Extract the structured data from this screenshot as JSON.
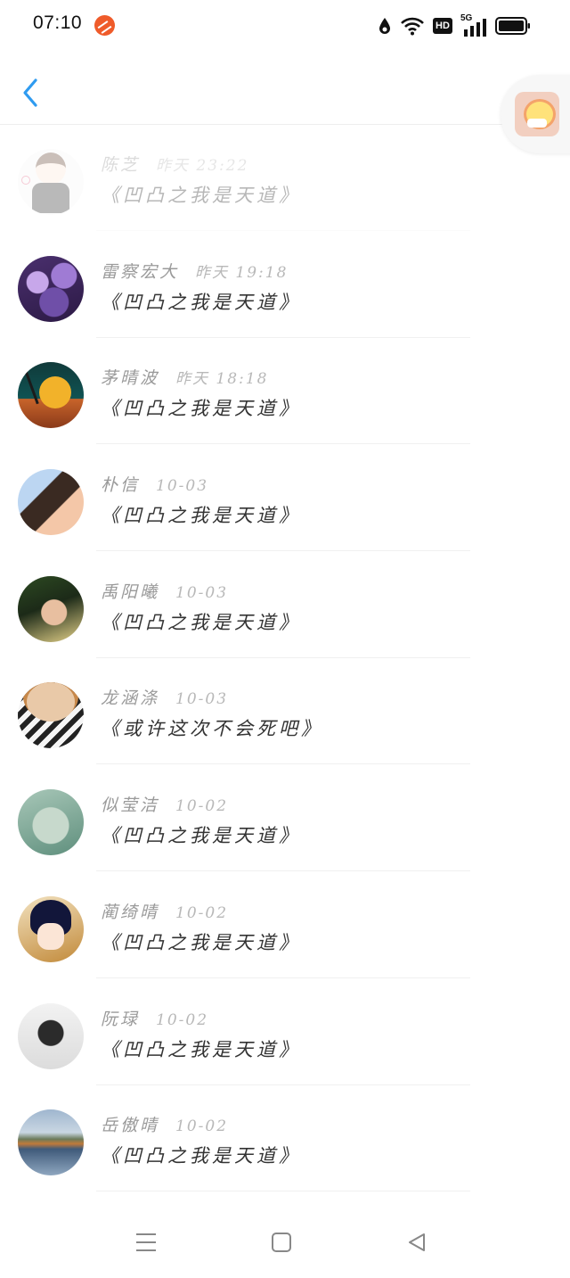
{
  "status_bar": {
    "time": "07:10",
    "icons": [
      "app-notification-icon",
      "water-drop-icon",
      "wifi-icon",
      "hd-icon",
      "signal-5g-icon",
      "battery-icon"
    ],
    "hd_label": "HD",
    "network_label": "5G"
  },
  "header": {
    "back_icon": "chevron-left-icon"
  },
  "colors": {
    "accent": "#2f9bf0",
    "name_text": "#9a9a9a",
    "time_text": "#b8b8b8",
    "content_text": "#333333"
  },
  "items": [
    {
      "name": "陈芝",
      "time": "昨天 23:22",
      "content": "《凹凸之我是天道》",
      "avatar": "cartoon-boy-avatar"
    },
    {
      "name": "雷察宏大",
      "time": "昨天 19:18",
      "content": "《凹凸之我是天道》",
      "avatar": "purple-flowers-avatar"
    },
    {
      "name": "茅晴波",
      "time": "昨天 18:18",
      "content": "《凹凸之我是天道》",
      "avatar": "moon-landscape-avatar"
    },
    {
      "name": "朴信",
      "time": "10-03",
      "content": "《凹凸之我是天道》",
      "avatar": "woman-portrait-avatar"
    },
    {
      "name": "禹阳曦",
      "time": "10-03",
      "content": "《凹凸之我是天道》",
      "avatar": "woman-outdoor-avatar"
    },
    {
      "name": "龙涵涤",
      "time": "10-03",
      "content": "《或许这次不会死吧》",
      "avatar": "girl-striped-avatar"
    },
    {
      "name": "似莹洁",
      "time": "10-02",
      "content": "《凹凸之我是天道》",
      "avatar": "misty-woman-avatar"
    },
    {
      "name": "蔺绮晴",
      "time": "10-02",
      "content": "《凹凸之我是天道》",
      "avatar": "anime-character-avatar"
    },
    {
      "name": "阮琭",
      "time": "10-02",
      "content": "《凹凸之我是天道》",
      "avatar": "girl-white-room-avatar"
    },
    {
      "name": "岳傲晴",
      "time": "10-02",
      "content": "《凹凸之我是天道》",
      "avatar": "lake-landscape-avatar"
    }
  ],
  "bottom_nav": {
    "icons": [
      "menu-icon",
      "home-icon",
      "back-triangle-icon"
    ]
  }
}
